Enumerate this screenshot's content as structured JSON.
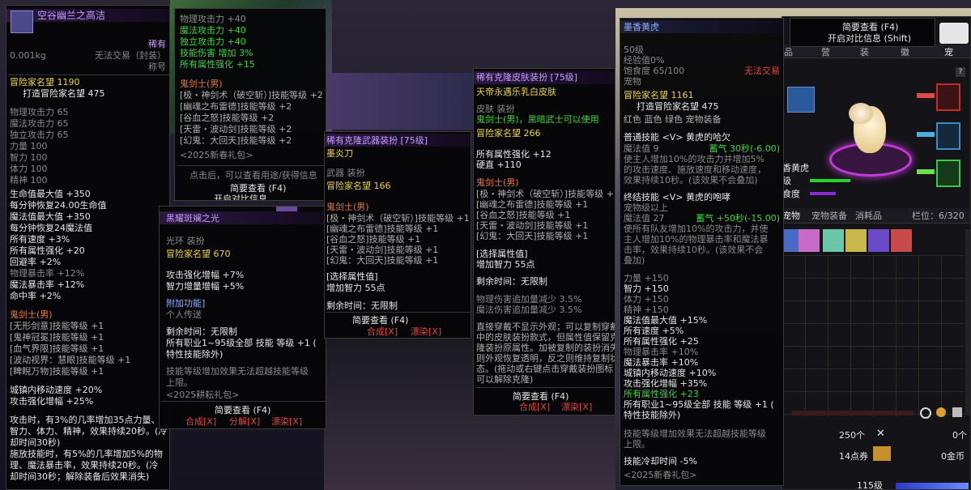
{
  "colors": {
    "rare_purple": "#b36bff",
    "green": "#3fd13f",
    "yellow": "#e8d24a",
    "red": "#e0463e"
  },
  "p1": {
    "title": "空谷幽兰之高洁",
    "rarity": "稀有",
    "weight": "0.001kg",
    "trade": "无法交易（封装）",
    "type": "称号",
    "fame": "冒险家名望 1190",
    "fame2": "打造冒险家名望 475",
    "stats": [
      "物理攻击力 65",
      "魔法攻击力 65",
      "独立攻击力 65",
      "力量 100",
      "智力 100",
      "体力 100",
      "精神 100"
    ],
    "stats2": [
      "生命值最大值 +350",
      "每分钟恢复24.00生命值",
      "魔法值最大值 +350",
      "每分钟恢复24魔法值",
      "所有速度 +3%",
      "所有属性强化 +20",
      "回避率 +2%",
      "物理暴击率 +12%",
      "魔法暴击率 +12%",
      "命中率 +2%"
    ],
    "job": "鬼剑士(男)",
    "skills": [
      "[无形剑意]技能等级 +1",
      "[鬼神冠冕]技能等级 +1",
      "[血气界限]技能等级 +1",
      "[波动视界：慧眼]技能等级 +1",
      "[睥睨万物]技能等级 +1"
    ],
    "move": "城镇内移动速度 +20%",
    "atk": "攻击强化增幅 +25%",
    "desc": [
      "攻击时，有3%的几率增加35点力量、",
      "智力、体力、精神，效果持续20秒。(冷",
      "却时间30秒)",
      "施放技能时，有5%的几率增加5%的物",
      "理、魔法暴击率，效果持续20秒。(冷",
      "却时间30秒；解除装备后效果消失)"
    ]
  },
  "p2": {
    "lines": [
      "物理攻击力 +40",
      "魔法攻击力 +40",
      "独立攻击力 +40",
      "技能伤害 增加 3%",
      "所有属性强化 +15"
    ],
    "job": "鬼剑士(男)",
    "skills": [
      "[极・神剑术（破空斩）]技能等级 +2",
      "[幽魂之布雷德]技能等级 +2",
      "[谷血之怒]技能等级 +2",
      "[天雷・波动剑]技能等级 +2",
      "[幻鬼：大回天]技能等级 +2"
    ],
    "pack": "<2025新春礼包>",
    "click_hint": "点击后，可以查看用途/获得信息",
    "brief": "简要查看 (F4)",
    "compare": "开启对比信息"
  },
  "p3": {
    "title": "黑耀斑斓之光",
    "type": "光环 装扮",
    "fame": "冒险家名望 670",
    "lines": [
      "攻击强化增幅 +7%",
      "智力增量增幅 +5%"
    ],
    "extra_title": "附加功能]",
    "extra": "个人传送",
    "remaining": "剩余时间：无限制",
    "all_job": "所有职业1~95级全部 技能 等级 +1 (",
    "all_job2": "特性技能除外)",
    "note1": "技能等级增加效果无法超越技能等级",
    "note2": "上限。",
    "pack": "<2025耕耘礼包>",
    "brief": "简要查看 (F4)",
    "compose": "合成[X]",
    "break": "分解[X]",
    "dye": "漂染[X]"
  },
  "p4": {
    "title": "稀有克隆武器装扮 [75级]",
    "name": "墨炎刀",
    "type": "武器 装扮",
    "fame": "冒险家名望 166",
    "job": "鬼剑士(男)",
    "skills": [
      "[极・神剑术（破空斩）]技能等级 +1",
      "[幽魂之布雷德]技能等级 +1",
      "[谷血之怒]技能等级 +1",
      "[天雷・波动剑]技能等级 +1",
      "[幻鬼：大回天]技能等级 +1"
    ],
    "choice": "[选择属性值]",
    "choice_val": "增加智力 55点",
    "remaining": "剩余时间：无限制",
    "brief": "简要查看 (F4)",
    "compose": "合成[X]",
    "dye": "漂染[X]"
  },
  "p5": {
    "title": "稀有克隆皮肤装扮 [75级]",
    "name": "天帝永遇乐乳白皮肤",
    "type": "皮肤 装扮",
    "job_line": "鬼剑士(男)，黑暗武士可以使用",
    "fame": "冒险家名望 266",
    "stat1": "所有属性强化 +12",
    "stat2": "硬直 +110",
    "job": "鬼剑士(男)",
    "skills": [
      "[极・神剑术（破空斩）]技能等级 +1",
      "[幽魂之布雷德]技能等级 +1",
      "[谷血之怒]技能等级 +1",
      "[天雷・波动剑]技能等级 +1",
      "[幻鬼：大回天]技能等级 +1"
    ],
    "choice": "[选择属性值]",
    "choice_val": "增加智力 55点",
    "remaining": "剩余时间：无限制",
    "red1": "物理伤害追加量减少 3.5%",
    "red2": "魔法伤害追加量减少 3.5%",
    "desc": [
      "直接穿戴不显示外观；可以复制穿戴",
      "中的皮肤装扮款式，但属性值保留克",
      "隆装扮原属性。加被复制的装扮消失",
      "则外观恢复透明，反之则维持复制状",
      "态。(拖动或右键点击穿戴装扮图标，",
      "可以解除克隆)"
    ],
    "brief": "简要查看 (F4)",
    "compose": "合成[X]",
    "dye": "漂染[X]"
  },
  "p6": {
    "title": "墨香黄虎",
    "level": "50级",
    "exp": "经验值0%",
    "food": "饱食度 65/100",
    "trade": "无法交易",
    "type": "宠物",
    "fame": "冒险家名望 1161",
    "fame2": "打造冒险家名望 475",
    "equip": "红色 蓝色 绿色 宠物装备",
    "skill1": "普通技能 <V> 黄虎的哈欠",
    "skill1_mp": "魔法值 9",
    "skill1_cd": "蓄气 30秒(-6.00)",
    "skill1_desc": [
      "使主人增加10%的攻击力并增加5%",
      "的攻击速度、施放速度和移动速度，",
      "效果持续10秒。(该效果不会叠加)"
    ],
    "skill2": "终结技能 <V> 黄虎的咆哮",
    "skill2_req": "宠物级以上",
    "skill2_mp": "魔法值 27",
    "skill2_cd": "蓄气 +50秒(-15.00)",
    "skill2_desc": [
      "使所有队友增加10%的攻击力，并使",
      "主人增加10%的物理暴击率和魔法暴",
      "击率，效果持续10秒。(该效果不会",
      "叠加)"
    ],
    "stats": [
      "力量 +150",
      "智力 +150",
      "体力 +150",
      "精神 +150"
    ],
    "stats2": [
      "魔法值最大值 +15%",
      "所有速度 +5%",
      "所有属性强化 +25",
      "物理暴击率 +10%",
      "魔法暴击率 +10%",
      "城镇内移动速度 +10%",
      "攻击强化增幅 +35%",
      "所有属性强化 +23"
    ],
    "all_job": "所有职业1~95级全部 技能 等级 +1 (",
    "all_job2": "特性技能除外)",
    "note1": "技能等级增加效果无法超越技能等级",
    "note2": "上限。",
    "cd_red": "技能冷却时间 -5%",
    "pack": "<2025新春礼包>"
  },
  "right_ui": {
    "brief": "简要查看 (F4)",
    "compare": "开启对比信息 (Shift)",
    "pet_name": "香黄虎",
    "lv_label": "级",
    "food_label": "食度",
    "tabs": [
      "宠物",
      "宠物装备",
      "消耗品"
    ],
    "slots": "栏位：6/320",
    "count": "250个",
    "count2": "0个",
    "coupon": "14点券",
    "gold": "0金币",
    "level": "115级"
  }
}
